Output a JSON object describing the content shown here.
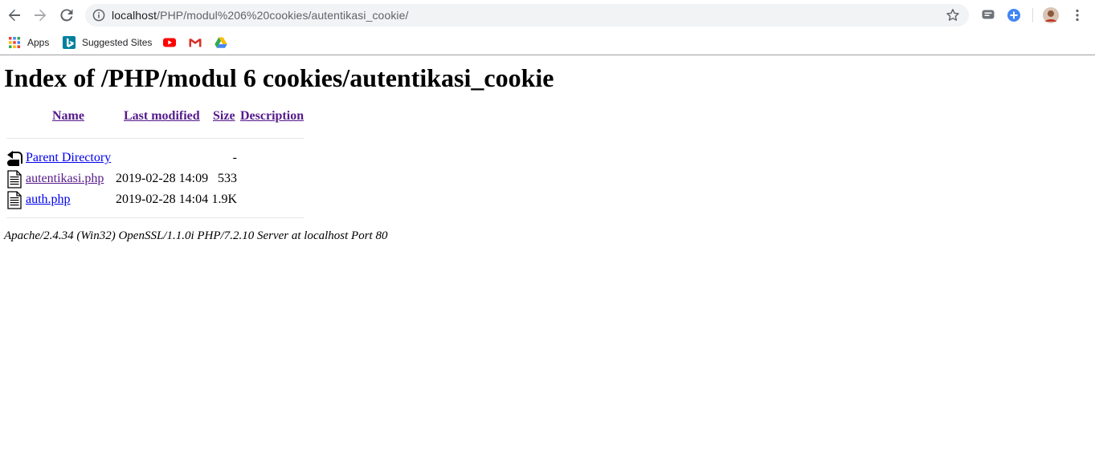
{
  "browser": {
    "url_host": "localhost",
    "url_path": "/PHP/modul%206%20cookies/autentikasi_cookie/",
    "bookmarks": [
      {
        "label": "Apps",
        "icon": "apps-grid-icon"
      },
      {
        "label": "Suggested Sites",
        "icon": "bing-icon"
      },
      {
        "label": "",
        "icon": "youtube-icon"
      },
      {
        "label": "",
        "icon": "gmail-icon"
      },
      {
        "label": "",
        "icon": "google-drive-icon"
      }
    ]
  },
  "page": {
    "title": "Index of /PHP/modul 6 cookies/autentikasi_cookie",
    "columns": {
      "name": "Name",
      "last_modified": "Last modified",
      "size": "Size",
      "description": "Description"
    },
    "rows": [
      {
        "name": "Parent Directory",
        "modified": "",
        "size": "-",
        "icon": "back-arrow-icon",
        "visited": false
      },
      {
        "name": "autentikasi.php",
        "modified": "2019-02-28 14:09",
        "size": "533",
        "icon": "text-file-icon",
        "visited": true
      },
      {
        "name": "auth.php",
        "modified": "2019-02-28 14:04",
        "size": "1.9K",
        "icon": "text-file-icon",
        "visited": false
      }
    ],
    "server_signature": "Apache/2.4.34 (Win32) OpenSSL/1.1.0i PHP/7.2.10 Server at localhost Port 80"
  },
  "colors": {
    "link": "#0000ee",
    "visited_link": "#551a8b",
    "omnibox_bg": "#f1f3f4"
  }
}
